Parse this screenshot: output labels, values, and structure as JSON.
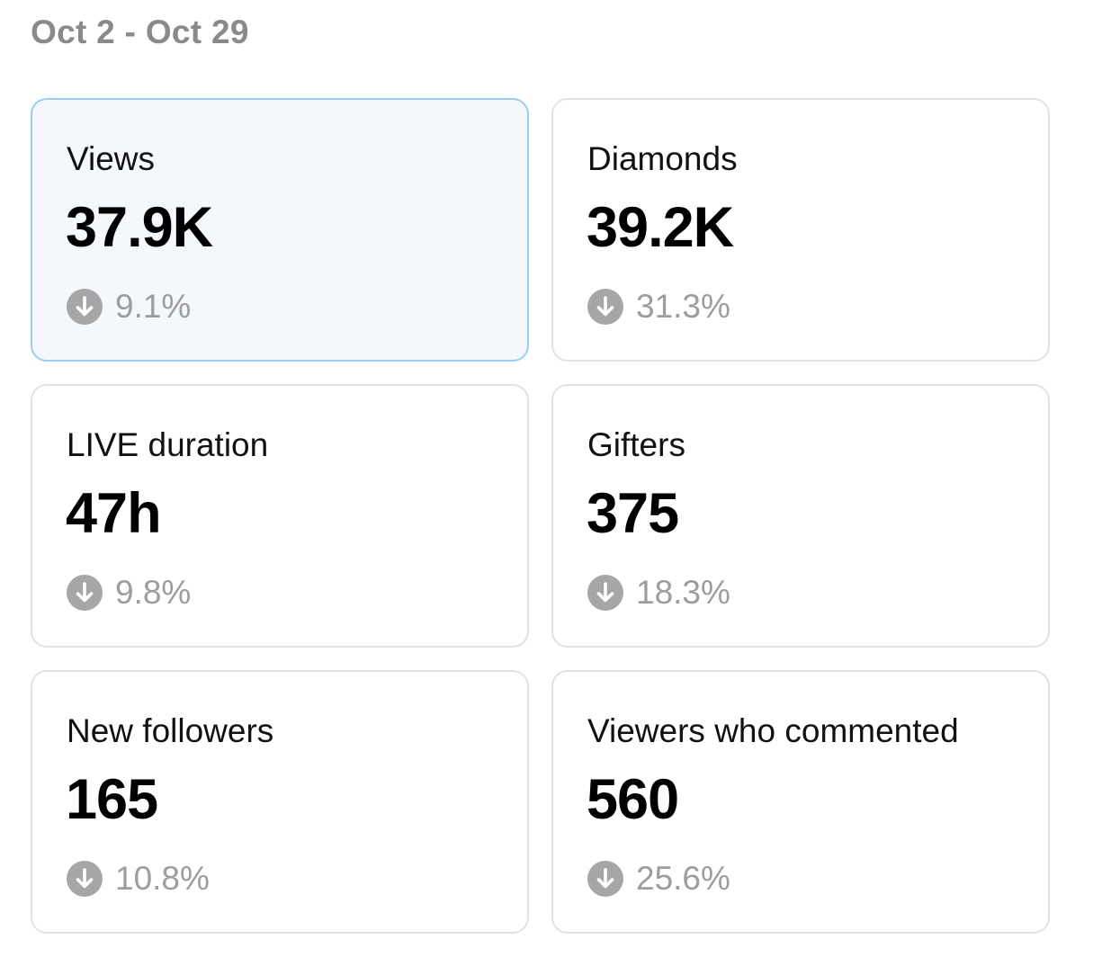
{
  "header": {
    "date_range": "Oct 2 - Oct 29"
  },
  "colors": {
    "selected_border": "#97cdf6",
    "selected_background": "#f4f7fc",
    "card_border": "#e2e2e2",
    "muted_text": "#9d9d9d",
    "icon_fill": "#a6a6a6"
  },
  "metrics": [
    {
      "label": "Views",
      "value": "37.9K",
      "change": "9.1%",
      "trend_icon": "arrow-down-circle-icon",
      "selected": true
    },
    {
      "label": "Diamonds",
      "value": "39.2K",
      "change": "31.3%",
      "trend_icon": "arrow-down-circle-icon",
      "selected": false
    },
    {
      "label": "LIVE duration",
      "value": "47h",
      "change": "9.8%",
      "trend_icon": "arrow-down-circle-icon",
      "selected": false
    },
    {
      "label": "Gifters",
      "value": "375",
      "change": "18.3%",
      "trend_icon": "arrow-down-circle-icon",
      "selected": false
    },
    {
      "label": "New followers",
      "value": "165",
      "change": "10.8%",
      "trend_icon": "arrow-down-circle-icon",
      "selected": false
    },
    {
      "label": "Viewers who commented",
      "value": "560",
      "change": "25.6%",
      "trend_icon": "arrow-down-circle-icon",
      "selected": false
    }
  ]
}
